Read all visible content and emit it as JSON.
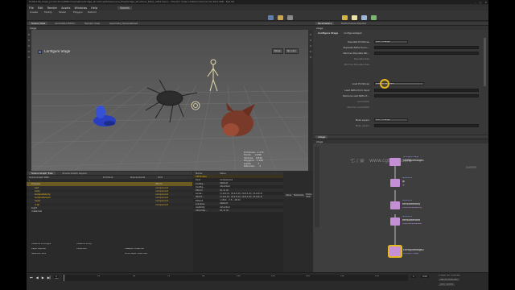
{
  "window": {
    "title": "H:/06-LSS_Class_productions/P86-Cinematics/bridge_structure/Notes/scene_files/bridge_structure_Katie_v001.hipnc - Houdini Indie Limited-Commercial 18.0.398 - Py2.50",
    "controls": [
      "–",
      "□",
      "✕"
    ]
  },
  "menu": [
    "File",
    "Edit",
    "Render",
    "Assets",
    "Windows",
    "Help",
    "Solaris"
  ],
  "desktop": {
    "label": "Solaris",
    "shelf_tabs": [
      "Create",
      "Modify",
      "Model",
      "Polygon",
      "Deform"
    ]
  },
  "viewport": {
    "tabs": [
      "Scene View",
      "Animation Editor",
      "Render View",
      "Geometry Spreadsheet"
    ],
    "context": "stage",
    "label": "Configure Stage",
    "camera_badge": "Persp",
    "cam_badge2": "No cam",
    "stats": "Primitives:  1,174\nPoints:     2,096\nVertices:   3,840\nPolygons:   1,160\nLights:         1\nMaterials:      4"
  },
  "scene_graph": {
    "tabs": [
      "Scene Graph Tree",
      "Scene Graph Layers"
    ],
    "columns": [
      "Scene Graph Path",
      "Primitive",
      "Descendants",
      "Kind"
    ],
    "rows": [
      {
        "name": "/",
        "kind": "",
        "sel": false
      },
      {
        "name": "Preview",
        "kind": "Xform",
        "sel": true
      },
      {
        "name": "bed",
        "kind": "component",
        "sel": false
      },
      {
        "name": "body",
        "kind": "component",
        "sel": false
      },
      {
        "name": "templatebody",
        "kind": "component",
        "sel": false
      },
      {
        "name": "templatehead",
        "kind": "component",
        "sel": false
      },
      {
        "name": "head",
        "kind": "component",
        "sel": false
      },
      {
        "name": "crab",
        "kind": "component",
        "sel": false
      },
      {
        "name": "Light",
        "kind": "",
        "sel": false
      },
      {
        "name": "materials",
        "kind": "",
        "sel": false
      }
    ],
    "legend": [
      "Instance Prototype",
      "Instance Proxy",
      "Layer Payload",
      "Collection",
      "Viewport Override",
      "Selection Rule",
      "Point Layer Overrides"
    ]
  },
  "attributes": {
    "columns": [
      "Name",
      "Value"
    ],
    "header": "Attributes",
    "rows": [
      {
        "name": "Kind",
        "value": "component"
      },
      {
        "name": "Config...",
        "value": "default"
      },
      {
        "name": "Config...",
        "value": "inherited"
      },
      {
        "name": "Xform",
        "value": "(0, 0, 0)"
      },
      {
        "name": "Local...",
        "value": "(1,0,0,0), (0,1,0,0), (0,0,1,0), (0,0,0,1)"
      },
      {
        "name": "World...",
        "value": "(1,0,0,0), (0,1,0,0), (0,0,1,0), (0,0,0,1)"
      },
      {
        "name": "Extent",
        "value": "(-18.0, -7.5, -18.0)"
      },
      {
        "name": "purpose",
        "value": "default"
      },
      {
        "name": "visibility",
        "value": "inherited"
      },
      {
        "name": "xformOp...",
        "value": "(0, 0, 0)"
      }
    ],
    "extra_columns": [
      "Value",
      "Metadata",
      "Extra Stat"
    ]
  },
  "parameters": {
    "tabs": [
      "Parameters",
      "Performance Monitor"
    ],
    "context": "stage",
    "node_type": "Configure Stage",
    "node_name": "configurestage2",
    "fields": [
      {
        "label": "Populate Primitives",
        "value": "Don't change"
      },
      {
        "label": "Populate Paths from I...",
        "value": ""
      },
      {
        "label": "Remove Populate Pat...",
        "value": ""
      },
      {
        "label": "Populate Rule",
        "value": ""
      },
      {
        "label": "Remove Populate Rule",
        "value": ""
      },
      {
        "label": "Load Primitives",
        "value": "Load All Payloads"
      },
      {
        "label": "Load Paths from Input",
        "value": ""
      },
      {
        "label": "Remove Load Paths fr...",
        "value": ""
      },
      {
        "label": "Load Paths",
        "value": ""
      },
      {
        "label": "Remove Load Paths",
        "value": ""
      },
      {
        "label": "Mute Layers",
        "value": "Don't change"
      },
      {
        "label": "Mute Layers",
        "value": ""
      }
    ]
  },
  "network": {
    "tabs": [
      "/stage"
    ],
    "context": "stage",
    "watermark": "七了要　www.cgtown.com",
    "solaris_label": "Solaris",
    "nodes": [
      {
        "title": "configurestage1",
        "sub": "Configure Stage",
        "path": ""
      },
      {
        "title": "gl",
        "sub": "Reference",
        "path": "/gl"
      },
      {
        "title": "templatebody",
        "sub": "Reference",
        "path": "/main/templatebody"
      },
      {
        "title": "templatehead",
        "sub": "Reference",
        "path": "/main/templatehead"
      },
      {
        "title": "configurestage2",
        "sub": "Configure Stage",
        "path": ""
      }
    ]
  },
  "timeline": {
    "frames": [
      "1",
      "24",
      "48",
      "72",
      "96",
      "120",
      "144",
      "168",
      "192",
      "216"
    ],
    "current": "1",
    "start": "1",
    "end": "240",
    "keys_label": "0 keys, 0/0 channels",
    "key_all": "Key All Channels",
    "auto_update": "Auto Update"
  },
  "colors": {
    "accent": "#e6b821",
    "node_pink": "#c58fd5",
    "selection": "#6b5a22"
  }
}
